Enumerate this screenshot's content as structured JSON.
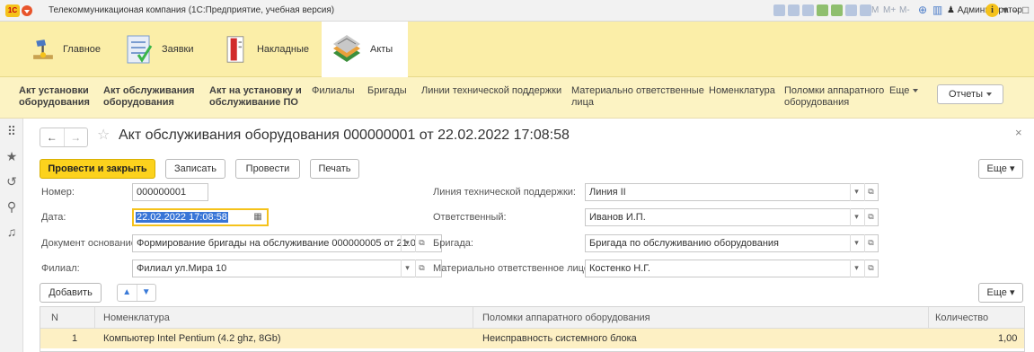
{
  "window": {
    "logo": "1С",
    "title": "Телекоммуникационая компания (1С:Предприятие, учебная версия)",
    "m_labels": [
      "M",
      "M+",
      "M-"
    ],
    "user": "Администратор",
    "info": "i"
  },
  "sections": [
    {
      "label": "Главное",
      "icon": "desk-lamp-icon"
    },
    {
      "label": "Заявки",
      "icon": "checklist-icon"
    },
    {
      "label": "Накладные",
      "icon": "invoice-icon"
    },
    {
      "label": "Акты",
      "icon": "documents-stack-icon",
      "active": true
    }
  ],
  "functions": {
    "items": [
      {
        "line1": "Акт установки",
        "line2": "оборудования",
        "bold": true
      },
      {
        "line1": "Акт обслуживания",
        "line2": "оборудования",
        "bold": true
      },
      {
        "line1": "Акт на установку и",
        "line2": "обслуживание ПО",
        "bold": true
      },
      {
        "line1": "Филиалы",
        "line2": ""
      },
      {
        "line1": "Бригады",
        "line2": ""
      },
      {
        "line1": "Линии технической поддержки",
        "line2": ""
      },
      {
        "line1": "Материально ответственные",
        "line2": "лица"
      },
      {
        "line1": "Номенклатура",
        "line2": ""
      },
      {
        "line1": "Поломки аппаратного",
        "line2": "оборудования"
      }
    ],
    "more": "Еще",
    "reports": "Отчеты"
  },
  "form": {
    "title": "Акт обслуживания оборудования 000000001 от 22.02.2022 17:08:58",
    "toolbar": {
      "post_close": "Провести и закрыть",
      "write": "Записать",
      "post": "Провести",
      "print": "Печать",
      "more": "Еще"
    },
    "fields": {
      "number_label": "Номер:",
      "number_value": "000000001",
      "date_label": "Дата:",
      "date_value": "22.02.2022 17:08:58",
      "basis_label": "Документ основание:",
      "basis_value": "Формирование бригады на обслуживание 000000005 от 21.0",
      "branch_label": "Филиал:",
      "branch_value": "Филиал ул.Мира 10",
      "line_label": "Линия технической поддержки:",
      "line_value": "Линия II",
      "responsible_label": "Ответственный:",
      "responsible_value": "Иванов И.П.",
      "brigade_label": "Бригада:",
      "brigade_value": "Бригада по обслуживанию оборудования",
      "mol_label": "Материально ответственное лицо:",
      "mol_value": "Костенко Н.Г."
    },
    "table_toolbar": {
      "add": "Добавить",
      "more": "Еще"
    },
    "table": {
      "columns": [
        "N",
        "Номенклатура",
        "Поломки аппаратного оборудования",
        "Количество"
      ],
      "rows": [
        {
          "n": "1",
          "item": "Компьютер Intel Pentium (4.2 ghz, 8Gb)",
          "fault": "Неисправность системного блока",
          "qty": "1,00"
        }
      ]
    }
  }
}
